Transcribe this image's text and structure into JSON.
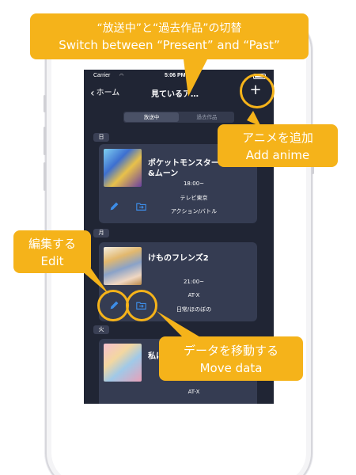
{
  "status_bar": {
    "carrier": "Carrier",
    "time": "5:06 PM"
  },
  "nav": {
    "back_label": "ホーム",
    "title": "見ているア…"
  },
  "segments": {
    "present": "放送中",
    "past": "過去作品"
  },
  "plus_label": "+",
  "days": {
    "sun": "日",
    "mon": "月",
    "tue": "火"
  },
  "cards": [
    {
      "title": "ポケットモンスター\n&ムーン",
      "time": "18:00~",
      "channel": "テレビ東京",
      "genre": "アクション/バトル"
    },
    {
      "title": "けものフレンズ2",
      "time": "21:00~",
      "channel": "AT-X",
      "genre": "日常/ほのぼの"
    },
    {
      "title": "私に",
      "channel": "AT-X"
    }
  ],
  "callouts": {
    "switch": {
      "line1": "“放送中”と“過去作品”の切替",
      "line2": "Switch between “Present” and “Past”"
    },
    "add": {
      "line1": "アニメを追加",
      "line2": "Add anime"
    },
    "edit": {
      "line1": "編集する",
      "line2": "Edit"
    },
    "move": {
      "line1": "データを移動する",
      "line2": "Move data"
    }
  },
  "colors": {
    "accent": "#f5b31a",
    "screen_bg": "#202534",
    "card_bg": "#353c52",
    "icon_blue": "#3d8de8"
  },
  "icons": [
    "chevron-left-icon",
    "wifi-icon",
    "battery-icon",
    "plus-icon",
    "pencil-icon",
    "folder-move-icon"
  ]
}
